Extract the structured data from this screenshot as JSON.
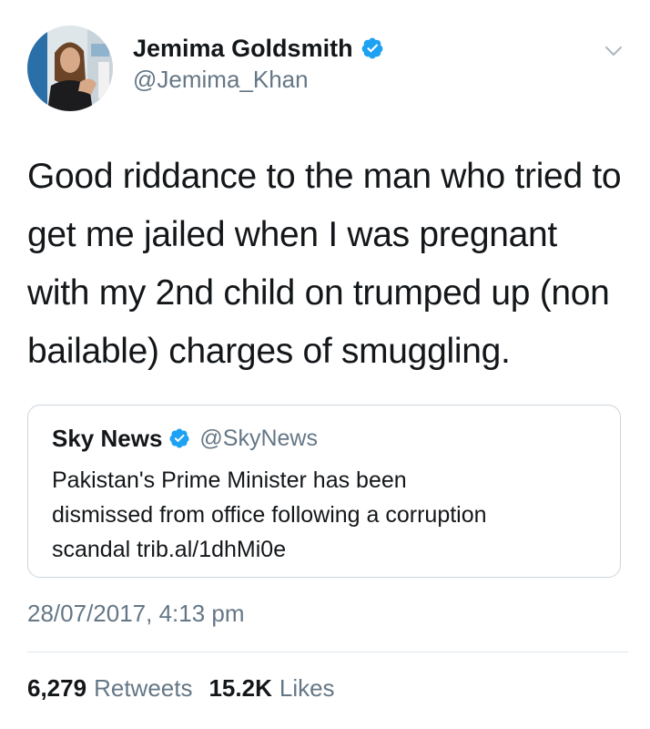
{
  "author": {
    "display_name": "Jemima Goldsmith",
    "handle": "@Jemima_Khan",
    "verified": true,
    "avatar_icon": "profile-photo"
  },
  "tweet": {
    "text": "Good riddance to the man who tried to\nget me jailed when I was pregnant\nwith my 2nd child on trumped up (non\nbailable) charges of smuggling.",
    "timestamp": "28/07/2017, 4:13 pm"
  },
  "quoted_tweet": {
    "display_name": "Sky News",
    "handle": "@SkyNews",
    "verified": true,
    "text": "Pakistan's Prime Minister has been\ndismissed from office following a corruption\nscandal trib.al/1dhMi0e"
  },
  "stats": {
    "retweets_count": "6,279",
    "retweets_label": "Retweets",
    "likes_count": "15.2K",
    "likes_label": "Likes"
  },
  "colors": {
    "verified_blue": "#1da1f2",
    "secondary_text": "#657786",
    "primary_text": "#14171a",
    "border": "#ccd6dd"
  }
}
